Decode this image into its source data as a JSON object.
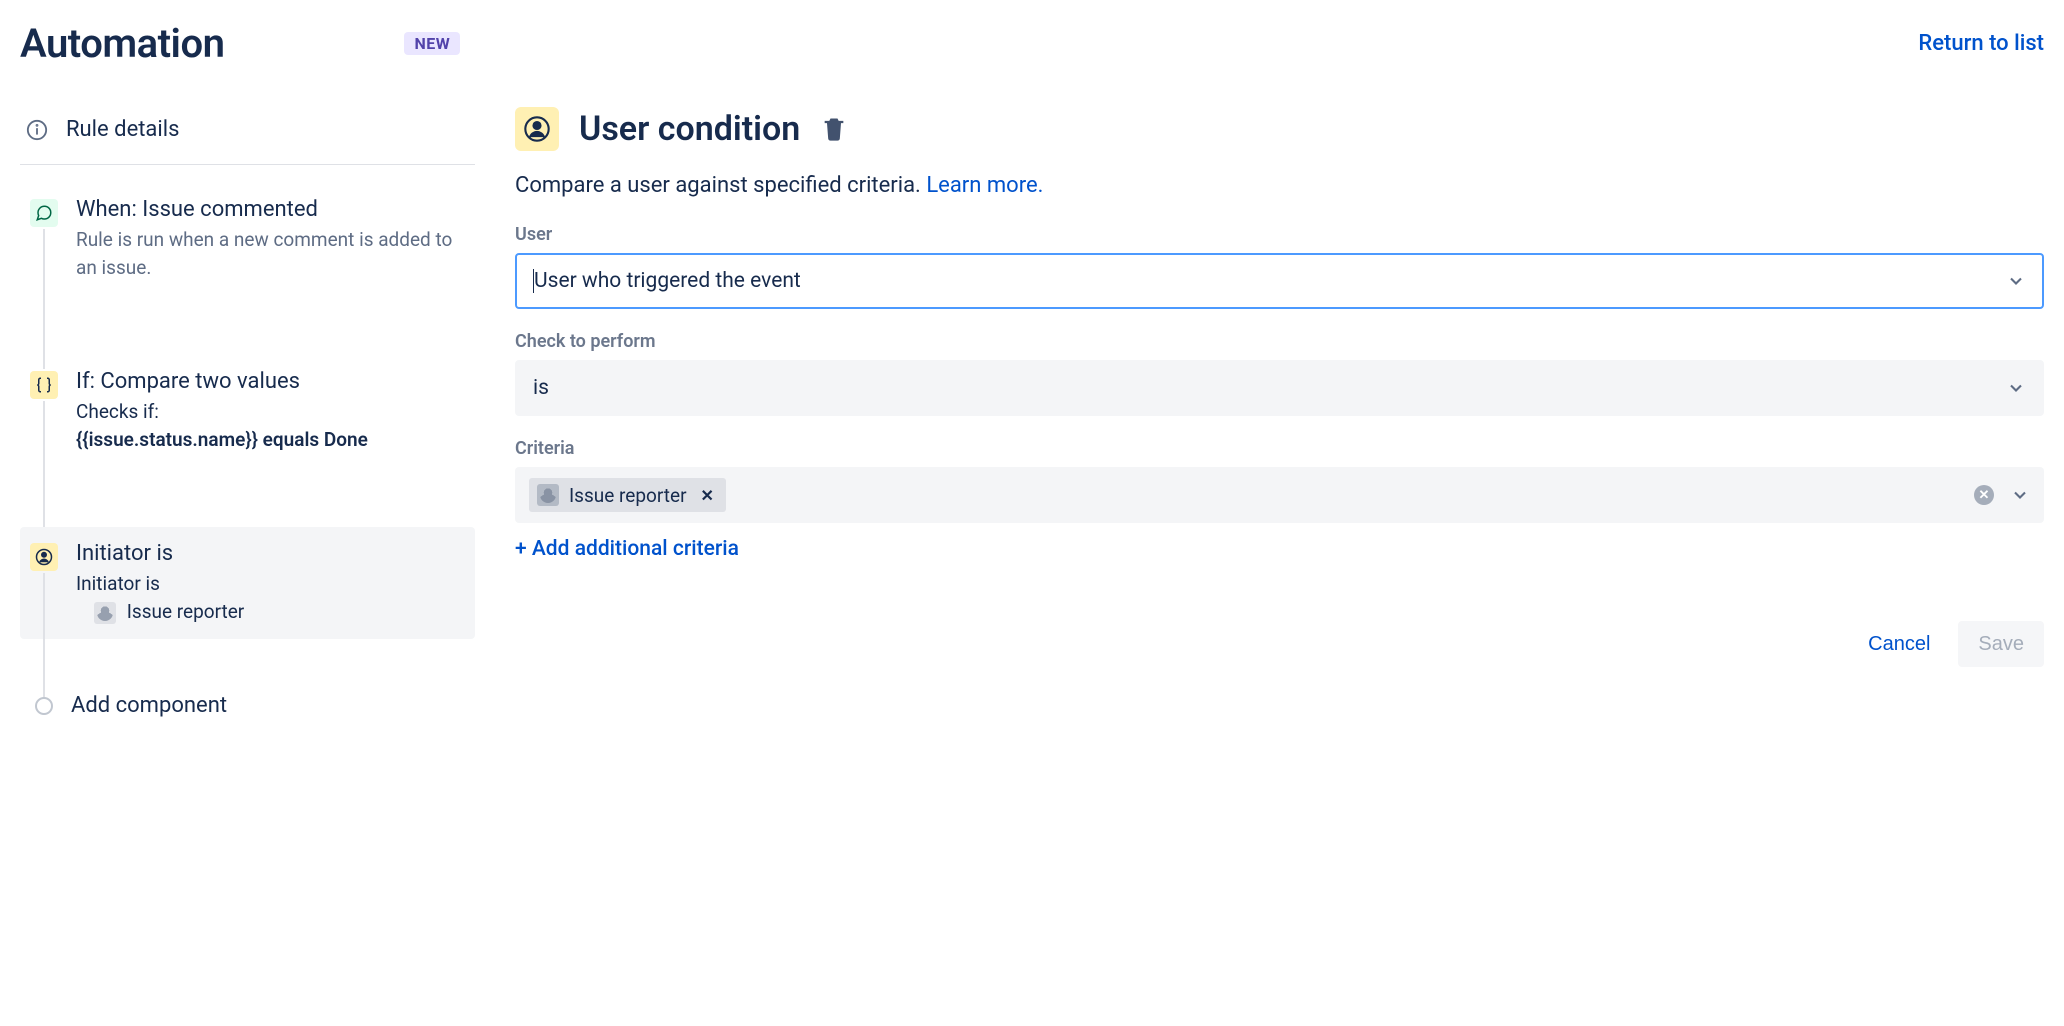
{
  "header": {
    "title": "Automation",
    "badge": "NEW",
    "return_link": "Return to list"
  },
  "sidebar": {
    "rule_details": "Rule details",
    "items": [
      {
        "title": "When: Issue commented",
        "desc": "Rule is run when a new comment is added to an issue."
      },
      {
        "title": "If: Compare two values",
        "desc_line1": "Checks if:",
        "desc_line2": "{{issue.status.name}} equals Done"
      },
      {
        "title": "Initiator is",
        "desc_line1": "Initiator is",
        "desc_chip": "Issue reporter"
      }
    ],
    "add_component": "Add component"
  },
  "main": {
    "title": "User condition",
    "desc_text": "Compare a user against specified criteria. ",
    "learn_more": "Learn more.",
    "user_label": "User",
    "user_value": "User who triggered the event",
    "check_label": "Check to perform",
    "check_value": "is",
    "criteria_label": "Criteria",
    "criteria_chip": "Issue reporter",
    "add_criteria": "+ Add additional criteria",
    "cancel": "Cancel",
    "save": "Save"
  }
}
